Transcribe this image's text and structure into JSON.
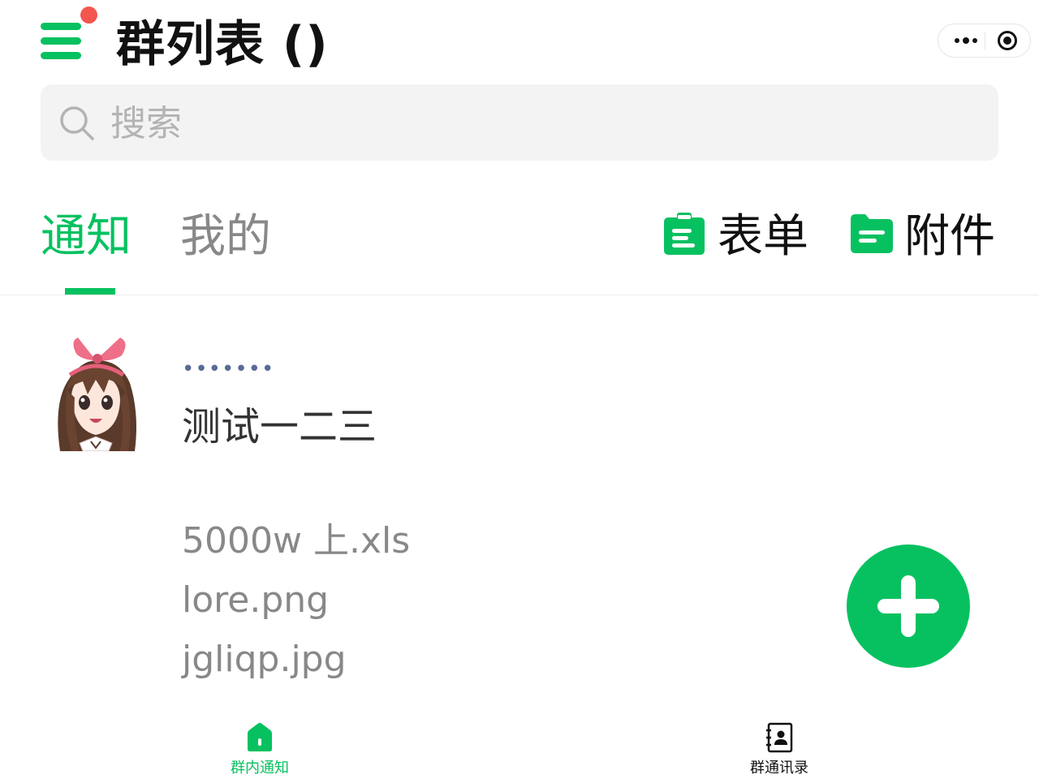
{
  "header": {
    "title": "群列表 ()",
    "has_notification_dot": true,
    "notification_dot_color": "#f3564e"
  },
  "capsule": {
    "more_icon": "more-dots-icon",
    "close_icon": "target-icon"
  },
  "search": {
    "placeholder": "搜索",
    "value": ""
  },
  "tabs": [
    {
      "label": "通知",
      "active": true
    },
    {
      "label": "我的",
      "active": false
    }
  ],
  "actions": [
    {
      "label": "表单",
      "icon": "clipboard-icon"
    },
    {
      "label": "附件",
      "icon": "folder-icon"
    }
  ],
  "notice": {
    "author": "•••••••",
    "content": "测试一二三",
    "attachments": [
      "5000w 上.xls",
      "lore.png",
      "jgliqp.jpg"
    ]
  },
  "fab": {
    "icon": "plus-icon"
  },
  "tabbar": [
    {
      "label": "群内通知",
      "icon": "home-icon",
      "active": true
    },
    {
      "label": "群通讯录",
      "icon": "contacts-book-icon",
      "active": false
    }
  ],
  "colors": {
    "accent": "#07c160",
    "link": "#576b95",
    "muted": "#888888"
  }
}
